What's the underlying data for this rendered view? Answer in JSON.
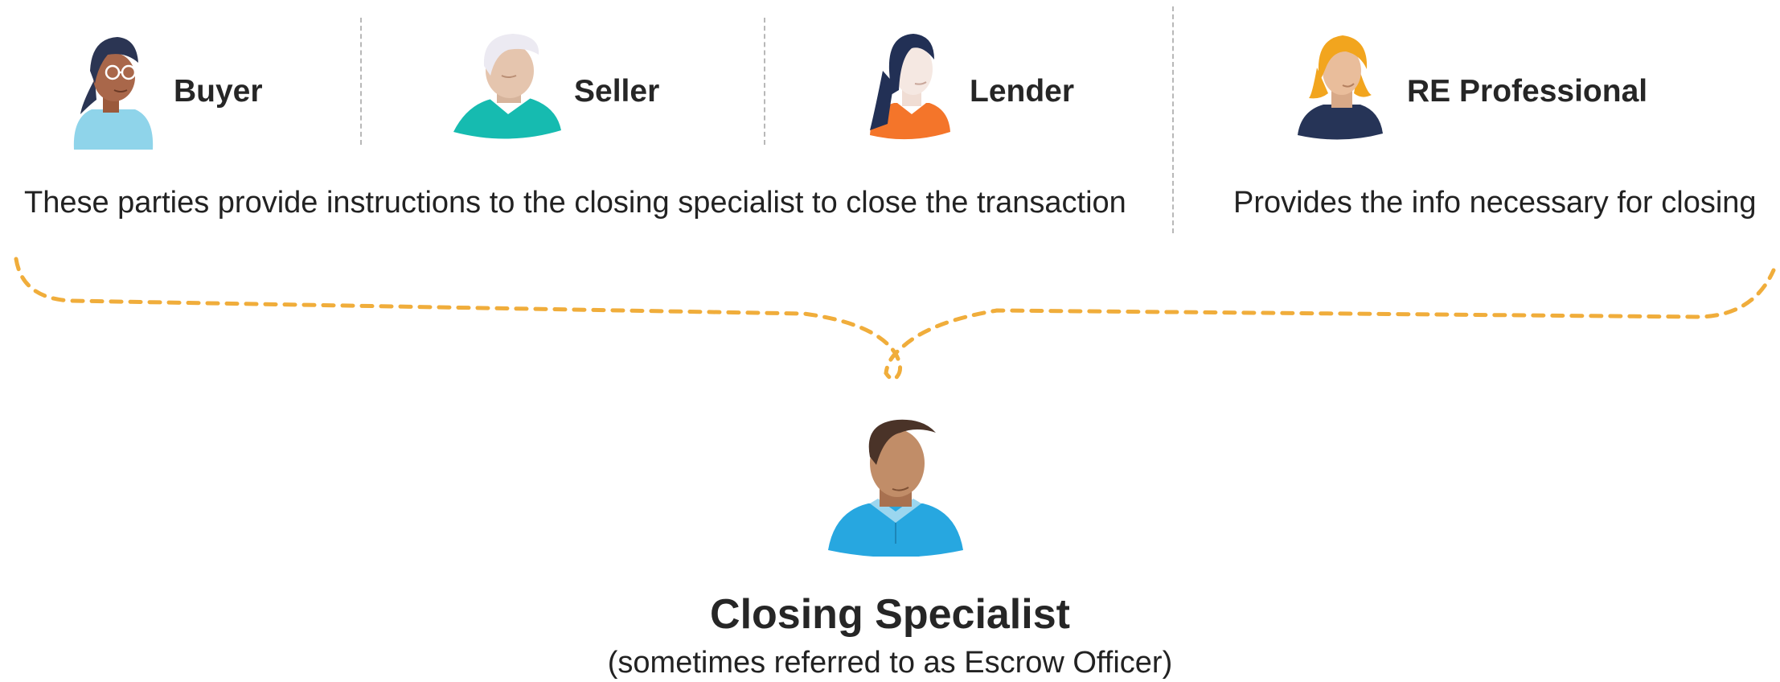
{
  "parties": [
    {
      "label": "Buyer",
      "icon": "buyer-avatar-icon"
    },
    {
      "label": "Seller",
      "icon": "seller-avatar-icon"
    },
    {
      "label": "Lender",
      "icon": "lender-avatar-icon"
    },
    {
      "label": "RE Professional",
      "icon": "re-professional-avatar-icon"
    }
  ],
  "descriptions": {
    "instructing_parties": "These parties provide instructions to the closing specialist to close the transaction",
    "re_professional": "Provides the info necessary for closing"
  },
  "closing_specialist": {
    "title": "Closing Specialist",
    "subtitle": "(sometimes referred to as Escrow Officer)",
    "icon": "closing-specialist-avatar-icon"
  },
  "colors": {
    "brace": "#f0ad3b",
    "divider": "#b8b8b8",
    "text": "#222222"
  }
}
